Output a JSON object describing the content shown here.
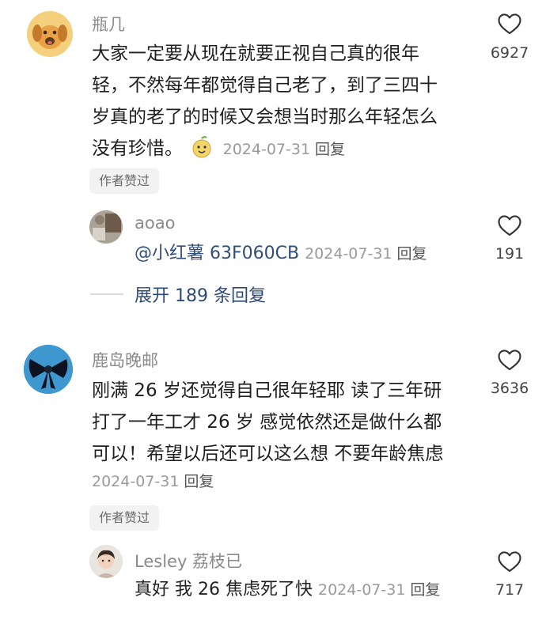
{
  "comments": [
    {
      "username": "瓶几",
      "text_lines": [
        "大家一定要从现在就要正视自己真的很年",
        "轻，不然每年都觉得自己老了，到了三四十",
        "岁真的老了的时候又会想当时那么年轻怎么",
        "没有珍惜。"
      ],
      "emoji": "pear-face-emoji",
      "date": "2024-07-31",
      "reply_label": "回复",
      "likes": "6927",
      "author_tag": "作者赞过",
      "sub_reply": {
        "username": "aoao",
        "mention": "@小红薯 63F060CB",
        "date": "2024-07-31",
        "reply_label": "回复",
        "likes": "191"
      },
      "expand_label": "展开 189 条回复"
    },
    {
      "username": "鹿岛晚邮",
      "text_lines": [
        "刚满 26 岁还觉得自己很年轻耶 读了三年研",
        "打了一年工才 26 岁 感觉依然还是做什么都",
        "可以！希望以后还可以这么想 不要年龄焦虑"
      ],
      "date": "2024-07-31",
      "reply_label": "回复",
      "likes": "3636",
      "author_tag": "作者赞过",
      "sub_reply": {
        "username": "Lesley 荔枝已",
        "text": "真好 我 26 焦虑死了快",
        "date": "2024-07-31",
        "reply_label": "回复",
        "likes": "717"
      }
    }
  ],
  "icons": {
    "like": "heart-outline-icon"
  },
  "colors": {
    "username": "#8a8a8a",
    "mention": "#2f4f7a",
    "expand": "#2b4a78",
    "tag_bg": "#f2f2f2"
  }
}
